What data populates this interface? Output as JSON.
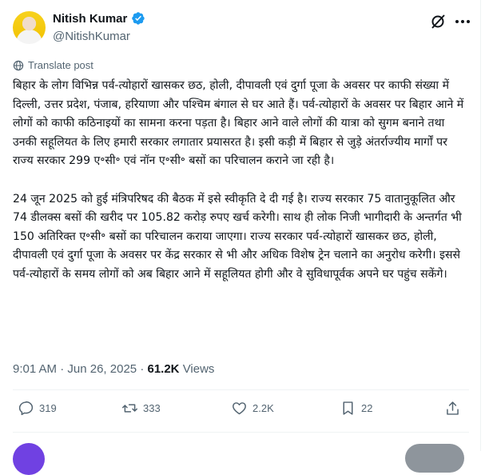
{
  "author": {
    "name": "Nitish Kumar",
    "handle": "@NitishKumar"
  },
  "header_icons": [
    "grok-icon",
    "more-icon"
  ],
  "translate_label": "Translate post",
  "post": {
    "text": "बिहार के लोग विभिन्न पर्व-त्योहारों खासकर छठ, होली, दीपावली एवं दुर्गा पूजा के अवसर पर काफी संख्या में दिल्ली, उत्तर प्रदेश, पंजाब, हरियाणा और पश्चिम बंगाल से घर आते हैं। पर्व-त्योहारों के अवसर पर बिहार आने में लोगों को काफी कठिनाइयों का सामना करना पड़ता है। बिहार आने वाले लोगों की यात्रा को सुगम बनाने तथा उनकी सहूलियत के लिए हमारी सरकार लगातार प्रयासरत है। इसी कड़ी में बिहार से जुड़े अंतर्राज्यीय मार्गों पर राज्य सरकार 299 ए॰सी॰ एवं नॉन ए॰सी॰ बसों का परिचालन कराने जा रही है।\n\n24 जून 2025 को हुई मंत्रिपरिषद की बैठक में इसे स्वीकृति दे दी गई है। राज्य सरकार 75 वातानुकूलित और 74 डीलक्स बसों की खरीद पर 105.82 करोड़ रुपए खर्च करेगी। साथ ही लोक निजी भागीदारी के अन्तर्गत भी 150 अतिरिक्त ए॰सी॰ बसों का परिचालन कराया जाएगा। राज्य सरकार पर्व-त्योहारों खासकर छठ, होली, दीपावली एवं दुर्गा पूजा के अवसर पर केंद्र सरकार से भी और अधिक विशेष ट्रेन चलाने का अनुरोध करेगी। इससे पर्व-त्योहारों के समय लोगों को अब बिहार आने में सहूलियत होगी और वे सुविधापूर्वक अपने घर पहुंच सकेंगे।",
    "time": "9:01 AM",
    "date": "Jun 26, 2025",
    "separator": "·",
    "views_count": "61.2K",
    "views_label": "Views"
  },
  "actions": {
    "replies": "319",
    "reposts": "333",
    "likes": "2.2K",
    "bookmarks": "22"
  },
  "colors": {
    "verified": "#1d9bf0",
    "secondary_text": "#536471",
    "divider": "#eff3f4"
  }
}
